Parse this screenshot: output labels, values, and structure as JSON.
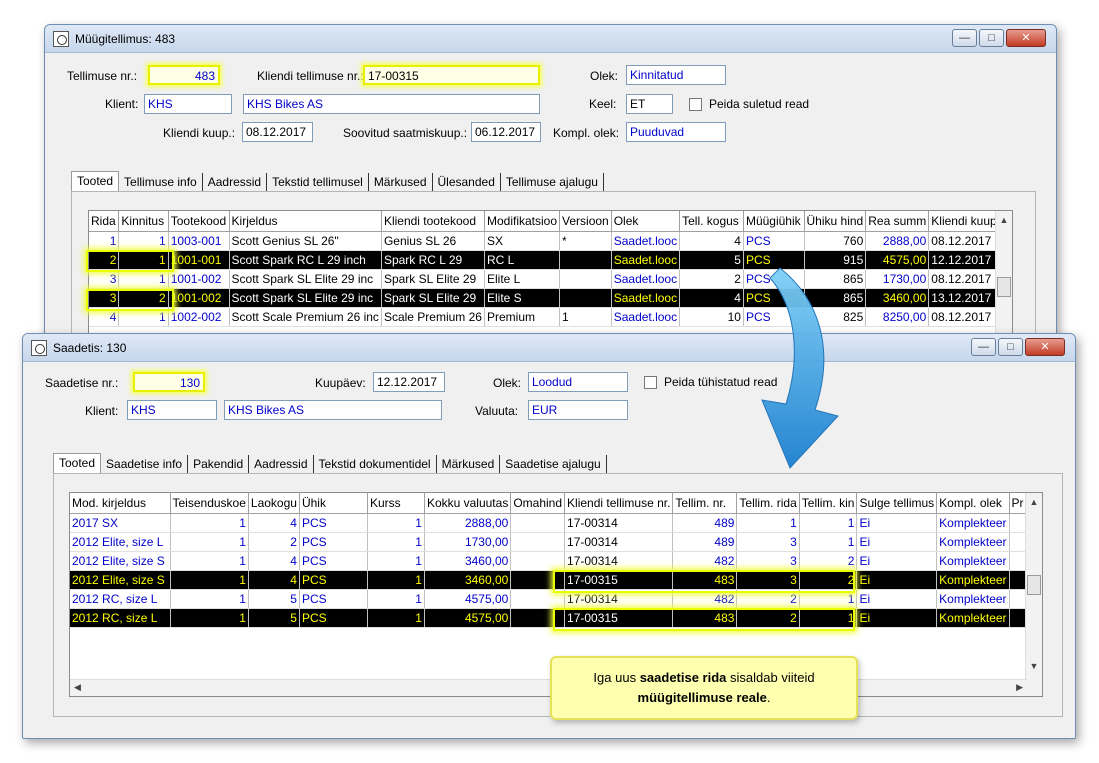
{
  "colors": {
    "accent_blue": "#0000cc",
    "highlight_yellow": "#eaff00",
    "selected_row_bg": "#000000",
    "arrow_blue": "#2a9be0",
    "callout_bg": "#ffffb0"
  },
  "order_window": {
    "title": "Müügitellimus: 483",
    "order_no_label": "Tellimuse nr.:",
    "order_no": "483",
    "client_order_no_label": "Kliendi tellimuse nr.:",
    "client_order_no": "17-00315",
    "status_label": "Olek:",
    "status": "Kinnitatud",
    "client_label": "Klient:",
    "client_code": "KHS",
    "client_name": "KHS Bikes AS",
    "language_label": "Keel:",
    "language": "ET",
    "hide_closed_label": "Peida suletud read",
    "client_date_label": "Kliendi kuup.:",
    "client_date": "08.12.2017",
    "desired_ship_label": "Soovitud saatmiskuup.:",
    "desired_ship_date": "06.12.2017",
    "complete_status_label": "Kompl. olek:",
    "complete_status": "Puuduvad",
    "tabs": [
      "Tooted",
      "Tellimuse info",
      "Aadressid",
      "Tekstid tellimusel",
      "Märkused",
      "Ülesanded",
      "Tellimuse ajalugu"
    ],
    "columns": [
      "Rida",
      "Kinnitus",
      "Tootekood",
      "Kirjeldus",
      "Kliendi tootekood",
      "Modifikatsioo",
      "Versioon",
      "Olek",
      "Tell. kogus",
      "Müügiühik",
      "Ühiku hind",
      "Rea summ",
      "Kliendi kuup."
    ],
    "rows": [
      {
        "rida": "1",
        "kinnitus": "1",
        "kood": "1003-001",
        "kirjeldus": "Scott Genius SL 26\"",
        "kl_kood": "Genius SL 26",
        "mod": "SX",
        "ver": "*",
        "olek": "Saadet.looc",
        "kogus": "4",
        "yhik": "PCS",
        "hind": "760",
        "summa": "2888,00",
        "kuup": "08.12.2017",
        "sel": false
      },
      {
        "rida": "2",
        "kinnitus": "1",
        "kood": "1001-001",
        "kirjeldus": "Scott Spark RC L 29 inch",
        "kl_kood": "Spark RC L 29",
        "mod": "RC L",
        "ver": "",
        "olek": "Saadet.looc",
        "kogus": "5",
        "yhik": "PCS",
        "hind": "915",
        "summa": "4575,00",
        "kuup": "12.12.2017",
        "sel": true
      },
      {
        "rida": "3",
        "kinnitus": "1",
        "kood": "1001-002",
        "kirjeldus": "Scott Spark SL Elite 29 inc",
        "kl_kood": "Spark SL Elite 29",
        "mod": "Elite L",
        "ver": "",
        "olek": "Saadet.looc",
        "kogus": "2",
        "yhik": "PCS",
        "hind": "865",
        "summa": "1730,00",
        "kuup": "08.12.2017",
        "sel": false
      },
      {
        "rida": "3",
        "kinnitus": "2",
        "kood": "1001-002",
        "kirjeldus": "Scott Spark SL Elite 29 inc",
        "kl_kood": "Spark SL Elite 29",
        "mod": "Elite S",
        "ver": "",
        "olek": "Saadet.looc",
        "kogus": "4",
        "yhik": "PCS",
        "hind": "865",
        "summa": "3460,00",
        "kuup": "13.12.2017",
        "sel": true
      },
      {
        "rida": "4",
        "kinnitus": "1",
        "kood": "1002-002",
        "kirjeldus": "Scott Scale Premium 26 inc",
        "kl_kood": "Scale Premium 26",
        "mod": "Premium",
        "ver": "1",
        "olek": "Saadet.looc",
        "kogus": "10",
        "yhik": "PCS",
        "hind": "825",
        "summa": "8250,00",
        "kuup": "08.12.2017",
        "sel": false
      }
    ]
  },
  "shipment_window": {
    "title": "Saadetis: 130",
    "shipment_no_label": "Saadetise nr.:",
    "shipment_no": "130",
    "date_label": "Kuupäev:",
    "date": "12.12.2017",
    "status_label": "Olek:",
    "status": "Loodud",
    "hide_cancelled_label": "Peida tühistatud read",
    "client_label": "Klient:",
    "client_code": "KHS",
    "client_name": "KHS Bikes AS",
    "currency_label": "Valuuta:",
    "currency": "EUR",
    "tabs": [
      "Tooted",
      "Saadetise info",
      "Pakendid",
      "Aadressid",
      "Tekstid dokumentidel",
      "Märkused",
      "Saadetise ajalugu"
    ],
    "columns": [
      "Mod. kirjeldus",
      "Teisenduskoe",
      "Laokogu",
      "Ühik",
      "Kurss",
      "Kokku valuutas",
      "Omahind",
      "Kliendi tellimuse nr.",
      "Tellim. nr.",
      "Tellim. rida",
      "Tellim. kin",
      "Sulge tellimus",
      "Kompl. olek",
      "Pr"
    ],
    "rows": [
      {
        "mod": "2017 SX",
        "teis": "1",
        "lao": "4",
        "yhik": "PCS",
        "kurss": "1",
        "kokku": "2888,00",
        "omah": "",
        "kl_tell": "17-00314",
        "tell_nr": "489",
        "tell_rida": "1",
        "tell_kin": "1",
        "sulge": "Ei",
        "kompl": "Komplekteer",
        "sel": false
      },
      {
        "mod": "2012 Elite, size L",
        "teis": "1",
        "lao": "2",
        "yhik": "PCS",
        "kurss": "1",
        "kokku": "1730,00",
        "omah": "",
        "kl_tell": "17-00314",
        "tell_nr": "489",
        "tell_rida": "3",
        "tell_kin": "1",
        "sulge": "Ei",
        "kompl": "Komplekteer",
        "sel": false
      },
      {
        "mod": "2012 Elite, size S",
        "teis": "1",
        "lao": "4",
        "yhik": "PCS",
        "kurss": "1",
        "kokku": "3460,00",
        "omah": "",
        "kl_tell": "17-00314",
        "tell_nr": "482",
        "tell_rida": "3",
        "tell_kin": "2",
        "sulge": "Ei",
        "kompl": "Komplekteer",
        "sel": false
      },
      {
        "mod": "2012 Elite, size S",
        "teis": "1",
        "lao": "4",
        "yhik": "PCS",
        "kurss": "1",
        "kokku": "3460,00",
        "omah": "",
        "kl_tell": "17-00315",
        "tell_nr": "483",
        "tell_rida": "3",
        "tell_kin": "2",
        "sulge": "Ei",
        "kompl": "Komplekteer",
        "sel": true
      },
      {
        "mod": "2012 RC, size L",
        "teis": "1",
        "lao": "5",
        "yhik": "PCS",
        "kurss": "1",
        "kokku": "4575,00",
        "omah": "",
        "kl_tell": "17-00314",
        "tell_nr": "482",
        "tell_rida": "2",
        "tell_kin": "1",
        "sulge": "Ei",
        "kompl": "Komplekteer",
        "sel": false
      },
      {
        "mod": "2012 RC, size L",
        "teis": "1",
        "lao": "5",
        "yhik": "PCS",
        "kurss": "1",
        "kokku": "4575,00",
        "omah": "",
        "kl_tell": "17-00315",
        "tell_nr": "483",
        "tell_rida": "2",
        "tell_kin": "1",
        "sulge": "Ei",
        "kompl": "Komplekteer",
        "sel": true
      }
    ]
  },
  "callout": {
    "part1": "Iga uus ",
    "bold1": "saadetise rida",
    "part2": " sisaldab viiteid",
    "bold2": "müügitellimuse reale",
    "part3": "."
  }
}
